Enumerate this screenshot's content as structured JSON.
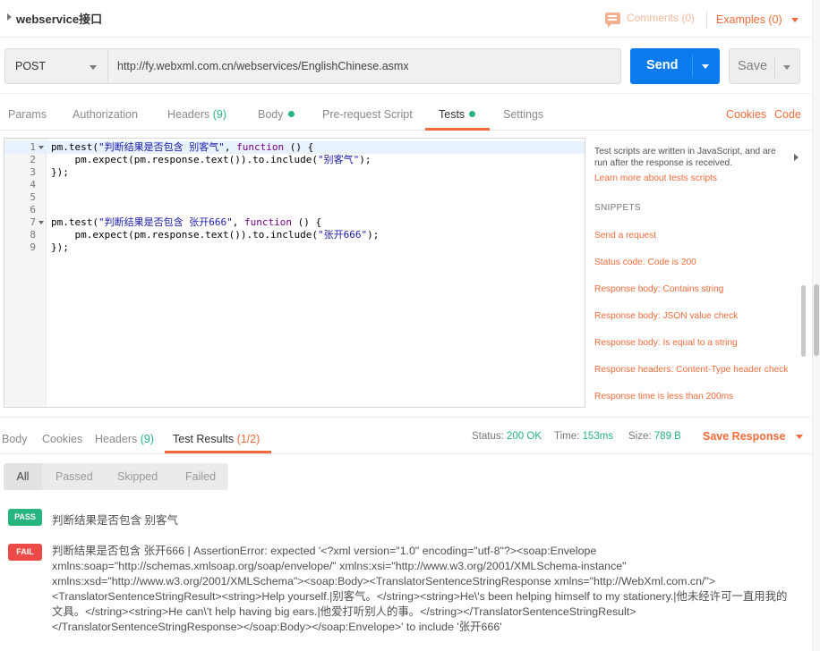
{
  "request": {
    "name": "webservice接口",
    "comments_label": "Comments (0)",
    "examples_label": "Examples (0)",
    "method": "POST",
    "url": "http://fy.webxml.com.cn/webservices/EnglishChinese.asmx",
    "send_label": "Send",
    "save_label": "Save"
  },
  "request_tabs": {
    "params": "Params",
    "authorization": "Authorization",
    "headers": "Headers",
    "headers_count": "(9)",
    "body": "Body",
    "prerequest": "Pre-request Script",
    "tests": "Tests",
    "settings": "Settings",
    "cookies": "Cookies",
    "code": "Code"
  },
  "editor": {
    "active_line": 1,
    "lines": [
      {
        "n": "1",
        "fold": true,
        "parts": [
          [
            "pm.test(",
            ""
          ],
          [
            "\"判断结果是否包含 别客气\"",
            "str"
          ],
          [
            ", ",
            ""
          ],
          [
            "function",
            "kw"
          ],
          [
            " () {",
            ""
          ]
        ]
      },
      {
        "n": "2",
        "fold": false,
        "parts": [
          [
            "    pm.expect(pm.response.text()).to.include(",
            ""
          ],
          [
            "\"别客气\"",
            "str"
          ],
          [
            ");",
            ""
          ]
        ]
      },
      {
        "n": "3",
        "fold": false,
        "parts": [
          [
            "});",
            ""
          ]
        ]
      },
      {
        "n": "4",
        "fold": false,
        "parts": []
      },
      {
        "n": "5",
        "fold": false,
        "parts": []
      },
      {
        "n": "6",
        "fold": false,
        "parts": []
      },
      {
        "n": "7",
        "fold": true,
        "parts": [
          [
            "pm.test(",
            ""
          ],
          [
            "\"判断结果是否包含 张开666\"",
            "str"
          ],
          [
            ", ",
            ""
          ],
          [
            "function",
            "kw"
          ],
          [
            " () {",
            ""
          ]
        ]
      },
      {
        "n": "8",
        "fold": false,
        "parts": [
          [
            "    pm.expect(pm.response.text()).to.include(",
            ""
          ],
          [
            "\"张开666\"",
            "str"
          ],
          [
            ");",
            ""
          ]
        ]
      },
      {
        "n": "9",
        "fold": false,
        "parts": [
          [
            "});",
            ""
          ]
        ]
      }
    ]
  },
  "snippets": {
    "intro": "Test scripts are written in JavaScript, and are run after the response is received.",
    "learn_more": "Learn more about tests scripts",
    "heading": "SNIPPETS",
    "items": [
      "Send a request",
      "Status code: Code is 200",
      "Response body: Contains string",
      "Response body: JSON value check",
      "Response body: Is equal to a string",
      "Response headers: Content-Type header check",
      "Response time is less than 200ms"
    ]
  },
  "response": {
    "tabs": {
      "body": "Body",
      "cookies": "Cookies",
      "headers": "Headers",
      "headers_count": "(9)",
      "test_results": "Test Results",
      "test_results_count": "(1/2)"
    },
    "status_label": "Status:",
    "status_value": "200 OK",
    "time_label": "Time:",
    "time_value": "153ms",
    "size_label": "Size:",
    "size_value": "789 B",
    "save_response": "Save Response"
  },
  "filters": {
    "all": "All",
    "passed": "Passed",
    "skipped": "Skipped",
    "failed": "Failed"
  },
  "results": {
    "pass_badge": "PASS",
    "pass_name": "判断结果是否包含 别客气",
    "fail_badge": "FAIL",
    "fail_message": "判断结果是否包含 张开666 | AssertionError: expected '<?xml version=\"1.0\" encoding=\"utf-8\"?><soap:Envelope xmlns:soap=\"http://schemas.xmlsoap.org/soap/envelope/\" xmlns:xsi=\"http://www.w3.org/2001/XMLSchema-instance\" xmlns:xsd=\"http://www.w3.org/2001/XMLSchema\"><soap:Body><TranslatorSentenceStringResponse xmlns=\"http://WebXml.com.cn/\"><TranslatorSentenceStringResult><string>Help yourself.|别客气。</string><string>He\\'s been helping himself to my stationery.|他未经许可一直用我的文具。</string><string>He can\\'t help having big ears.|他爱打听别人的事。</string></TranslatorSentenceStringResult></TranslatorSentenceStringResponse></soap:Body></soap:Envelope>' to include '张开666'"
  },
  "colors": {
    "accent": "#f26b3a",
    "send_blue": "#097bed",
    "success_green": "#26b47f",
    "fail_red": "#ed4b48"
  }
}
